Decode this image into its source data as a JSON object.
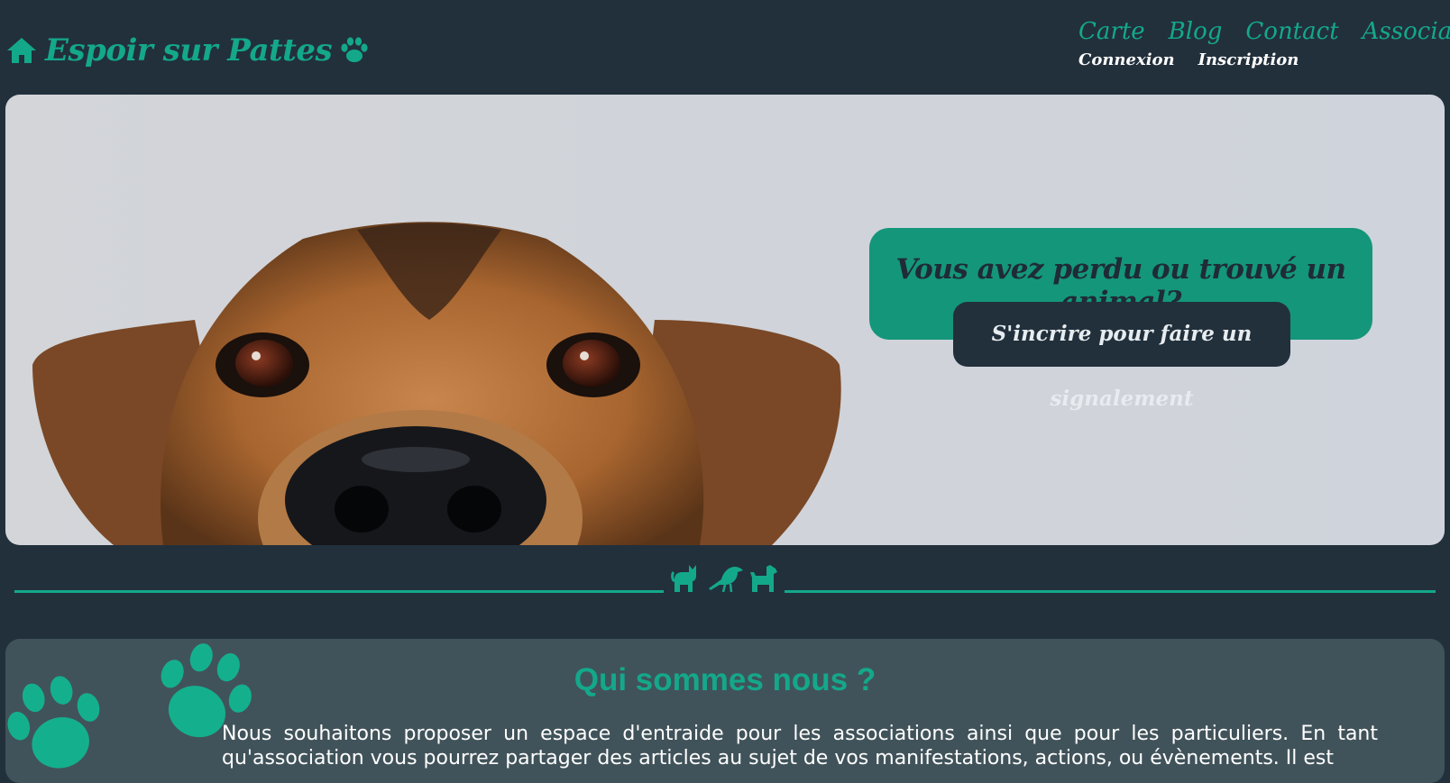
{
  "header": {
    "brand": "Espoir sur Pattes",
    "nav": {
      "main": [
        "Carte",
        "Blog",
        "Contact",
        "Associations"
      ],
      "account": [
        "Connexion",
        "Inscription"
      ]
    }
  },
  "hero": {
    "title": "Vous avez perdu ou trouvé un animal?",
    "button_label": "S'incrire pour faire un signalement"
  },
  "divider": {
    "icons": [
      "cat-icon",
      "crow-icon",
      "dog-icon"
    ]
  },
  "about": {
    "title": "Qui sommes nous ?",
    "text": "Nous souhaitons proposer un espace d'entraide pour les associations ainsi que pour les particuliers. En tant qu'association vous pourrez partager des articles au sujet de vos manifestations, actions, ou évènements. Il est"
  },
  "colors": {
    "background": "#22303c",
    "accent": "#14a88a",
    "cta_box": "#14967a",
    "about_panel": "#41535a"
  }
}
